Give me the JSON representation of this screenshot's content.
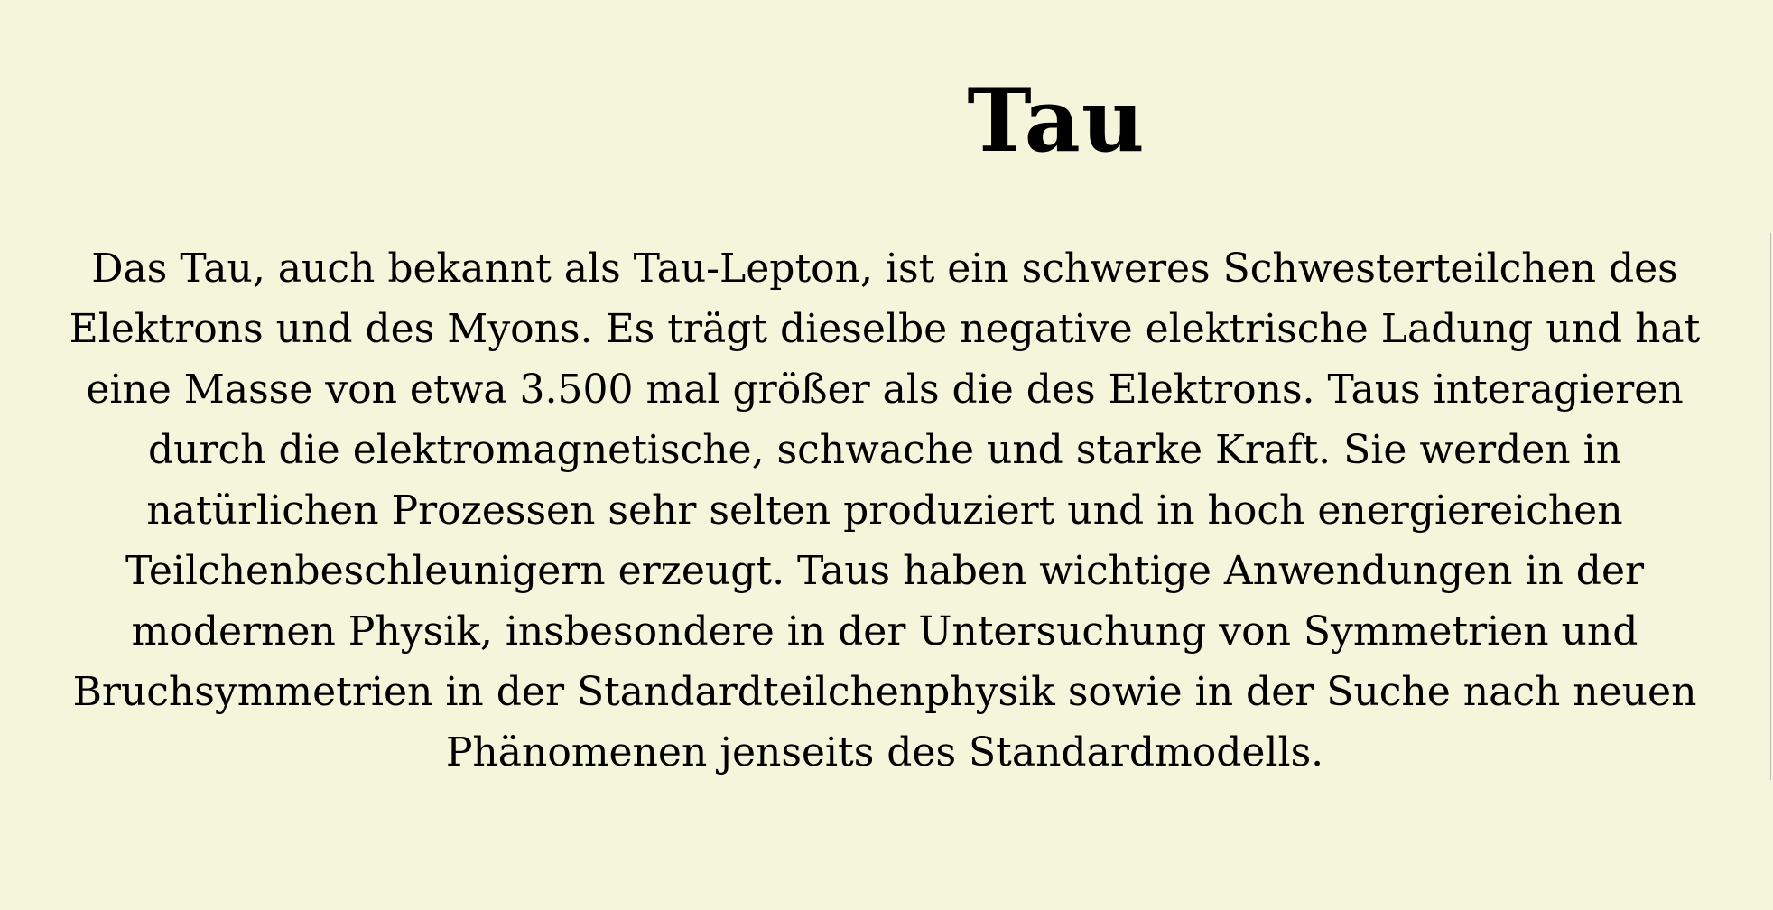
{
  "document": {
    "title": "Tau",
    "body": "Das Tau, auch bekannt als Tau-Lepton, ist ein schweres Schwesterteilchen des Elektrons und des Myons. Es trägt dieselbe negative elektrische Ladung und hat eine Masse von etwa 3.500 mal größer als die des Elektrons. Taus interagieren durch die elektromagnetische, schwache und starke Kraft. Sie werden in natürlichen Prozessen sehr selten produziert und in hoch energiereichen Teilchenbeschleunigern erzeugt. Taus haben wichtige Anwendungen in der modernen Physik, insbesondere in der Untersuchung von Symmetrien und Bruchsymmetrien in der Standardteilchenphysik sowie in der Suche nach neuen Phänomenen jenseits des Standardmodells."
  },
  "colors": {
    "background": "#f5f5dc",
    "text": "#000000"
  }
}
